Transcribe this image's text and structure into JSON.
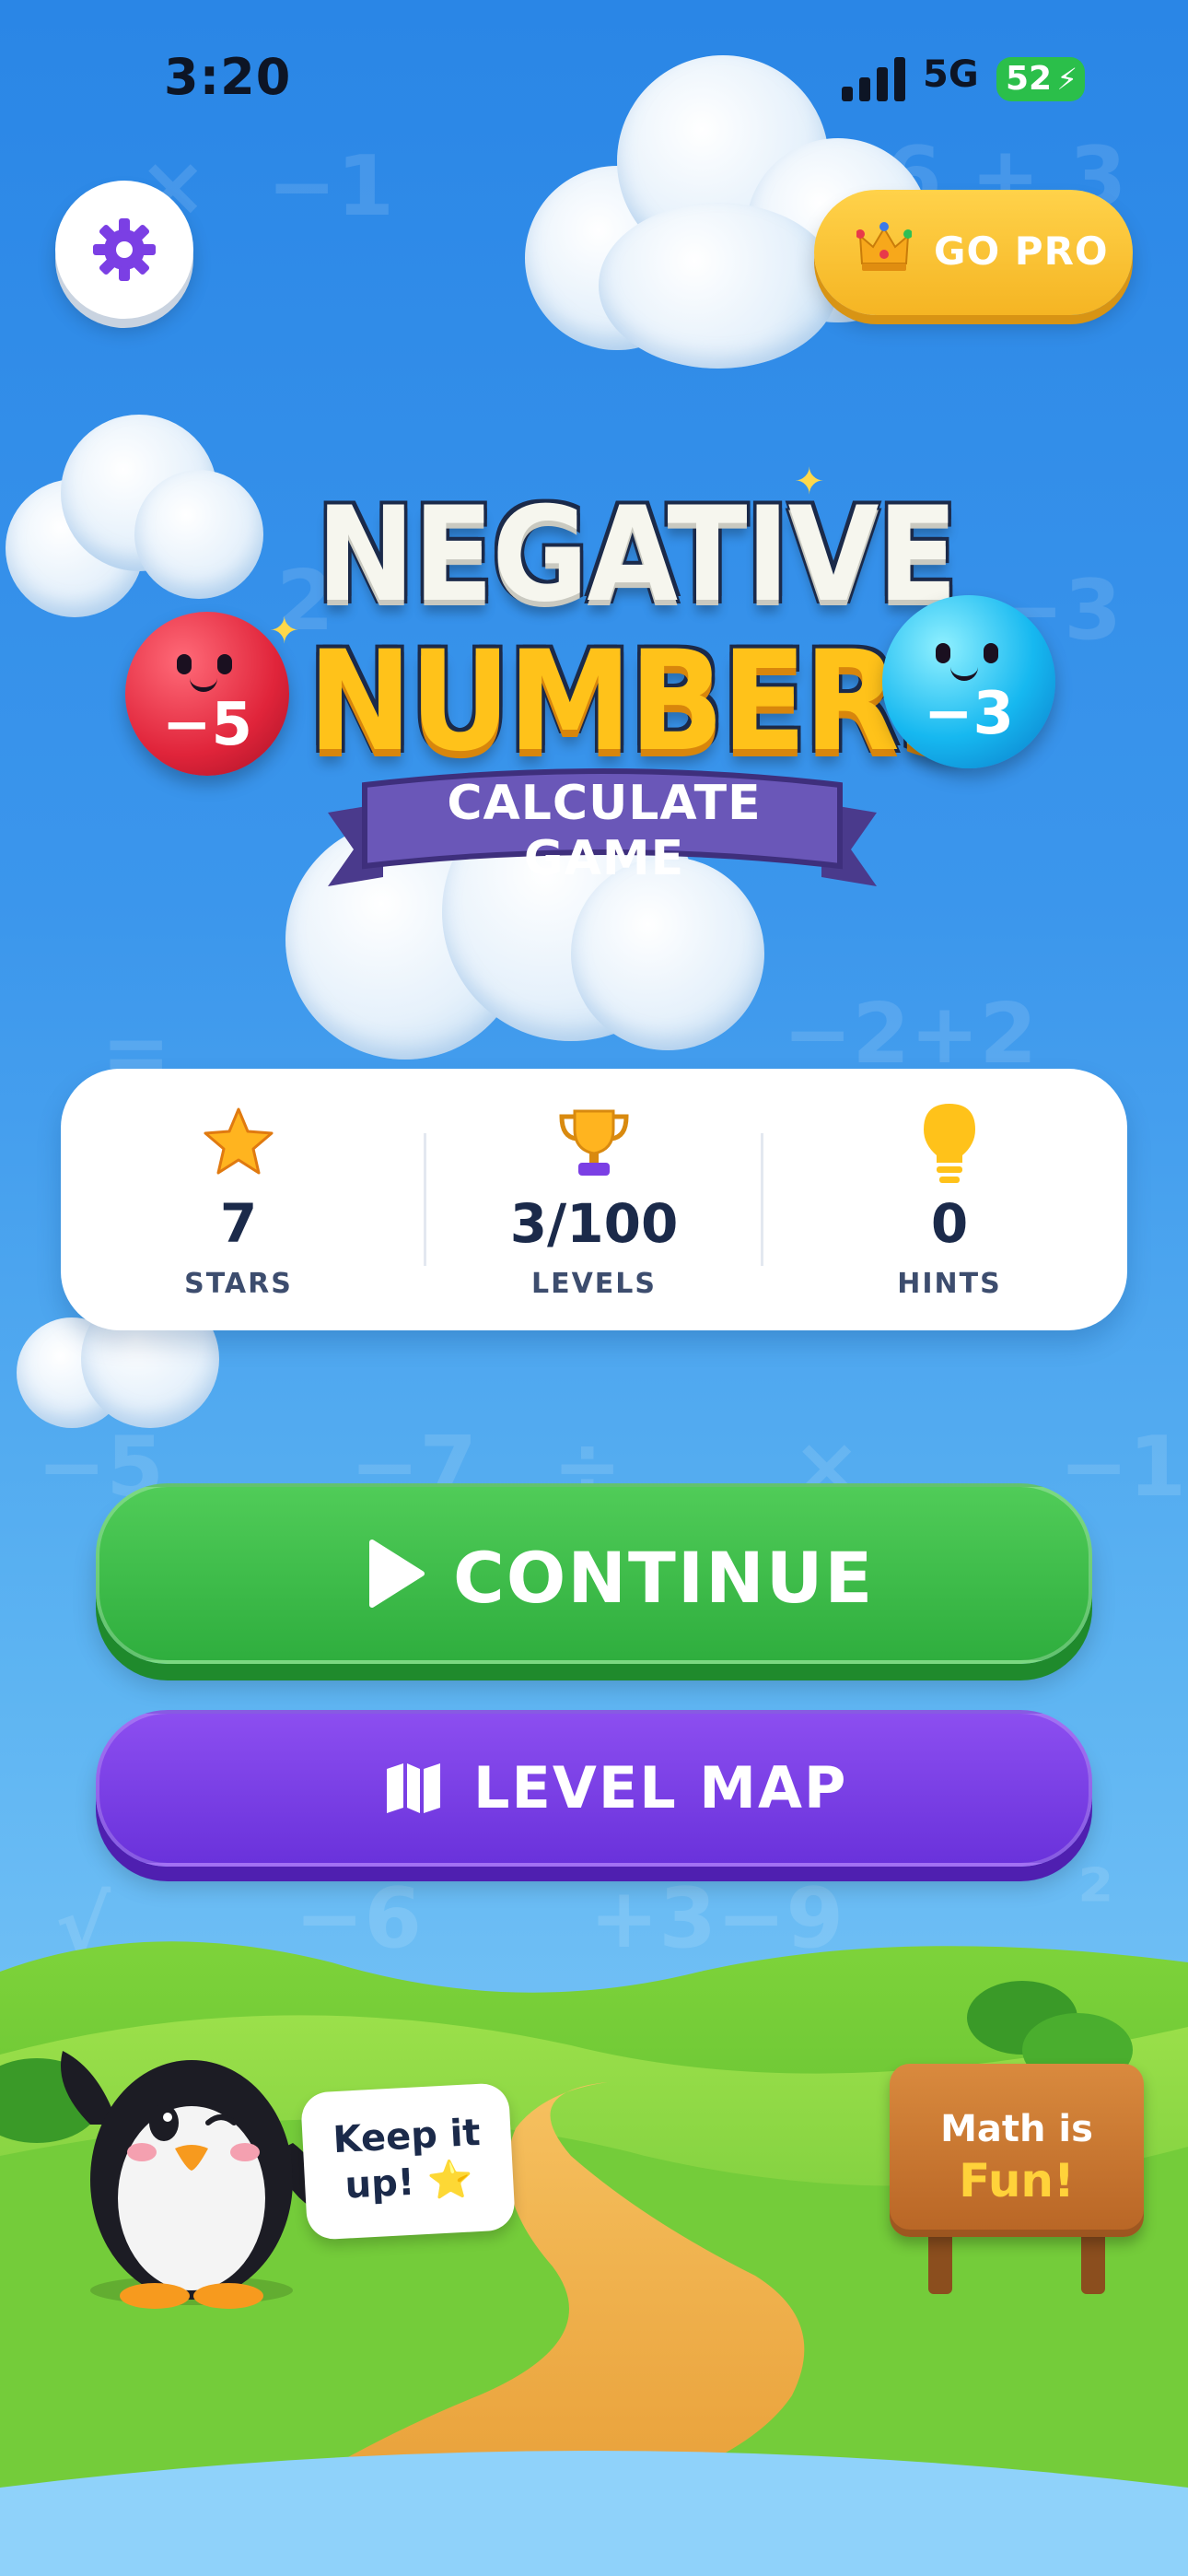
{
  "status_bar": {
    "time": "3:20",
    "network": "5G",
    "battery": "52"
  },
  "header": {
    "go_pro_label": "GO PRO"
  },
  "logo": {
    "line1": "NEGATIVE",
    "line2": "NUMBERS",
    "ribbon": "CALCULATE GAME",
    "left_ball": "−5",
    "right_ball": "−3"
  },
  "background_symbols": [
    "×",
    "−1",
    "6 + 3",
    "2",
    "−3",
    "=",
    "−2+2",
    "−5",
    "−7",
    "÷",
    "×",
    "−1",
    "√",
    "−6",
    "+3−9",
    "²"
  ],
  "stats": [
    {
      "value": "7",
      "label": "STARS",
      "icon": "star-icon"
    },
    {
      "value": "3/100",
      "label": "LEVELS",
      "icon": "trophy-icon"
    },
    {
      "value": "0",
      "label": "HINTS",
      "icon": "lightbulb-icon"
    }
  ],
  "buttons": {
    "continue_label": "CONTINUE",
    "level_map_label": "LEVEL MAP"
  },
  "mascot": {
    "speech_line1": "Keep it",
    "speech_line2": "up! ⭐"
  },
  "sign": {
    "line1": "Math is",
    "line2": "Fun!"
  },
  "colors": {
    "sky_top": "#2a86e6",
    "continue_green": "#3bbd47",
    "level_map_purple": "#7a3ee6",
    "go_pro_yellow": "#f9c433",
    "settings_gear": "#7b3fe4",
    "title_yellow": "#ffc21a"
  }
}
